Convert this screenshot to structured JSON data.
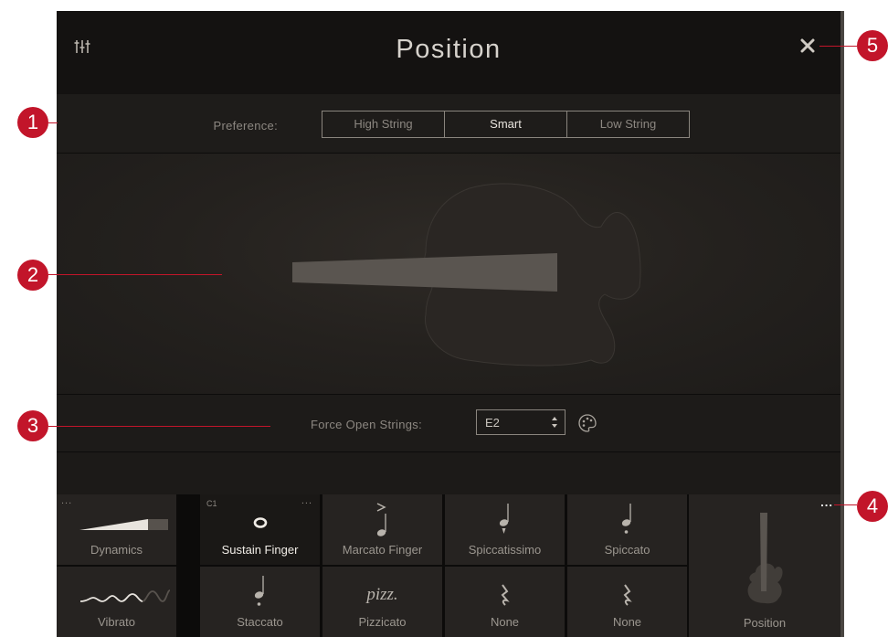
{
  "header": {
    "title": "Position"
  },
  "preference": {
    "label": "Preference:",
    "options": [
      "High String",
      "Smart",
      "Low String"
    ],
    "selected": "Smart"
  },
  "open_strings": {
    "label": "Force Open Strings:",
    "value": "E2"
  },
  "articulations": {
    "cells": [
      {
        "label": "Dynamics",
        "symbol": "dynamics-ramp-icon"
      },
      {
        "label": "Sustain Finger",
        "symbol": "whole-note-icon",
        "tag": "C1",
        "selected": true
      },
      {
        "label": "Marcato Finger",
        "symbol": "marcato-note-icon"
      },
      {
        "label": "Spiccatissimo",
        "symbol": "spiccatissimo-note-icon"
      },
      {
        "label": "Spiccato",
        "symbol": "spiccato-note-icon"
      },
      {
        "label": "Vibrato",
        "symbol": "vibrato-wave-icon"
      },
      {
        "label": "Staccato",
        "symbol": "staccato-note-icon"
      },
      {
        "label": "Pizzicato",
        "symbol": "pizz.",
        "text_symbol": "pizz."
      },
      {
        "label": "None",
        "symbol": "rest-icon"
      },
      {
        "label": "None",
        "symbol": "rest-icon"
      }
    ],
    "more_icon": "..."
  },
  "position_tile": {
    "label": "Position"
  },
  "callouts": [
    "1",
    "2",
    "3",
    "4",
    "5"
  ],
  "colors": {
    "accent": "#c2152a",
    "panel": "#1c1a18",
    "header": "#141211"
  }
}
